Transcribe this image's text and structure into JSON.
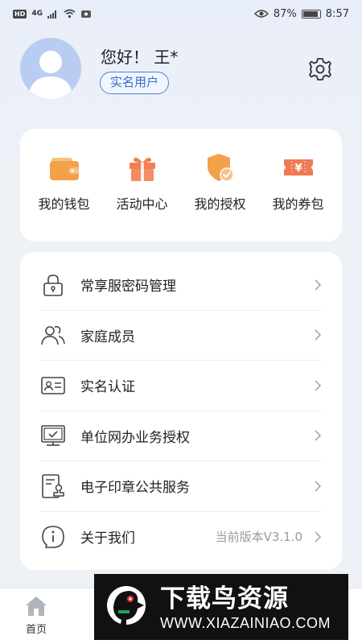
{
  "status_bar": {
    "hd": "HD",
    "network": "4G",
    "battery": "87%",
    "time": "8:57"
  },
  "profile": {
    "greeting": "您好！ 王*",
    "badge": "实名用户"
  },
  "quick_actions": [
    {
      "label": "我的钱包",
      "icon": "wallet-icon",
      "color": "#f4a14c"
    },
    {
      "label": "活动中心",
      "icon": "gift-icon",
      "color": "#f07f57"
    },
    {
      "label": "我的授权",
      "icon": "shield-check-icon",
      "color": "#f4a14c"
    },
    {
      "label": "我的券包",
      "icon": "coupon-icon",
      "color": "#f07a55"
    }
  ],
  "menu": [
    {
      "label": "常享服密码管理",
      "icon": "lock-icon",
      "extra": ""
    },
    {
      "label": "家庭成员",
      "icon": "family-icon",
      "extra": ""
    },
    {
      "label": "实名认证",
      "icon": "id-card-icon",
      "extra": ""
    },
    {
      "label": "单位网办业务授权",
      "icon": "monitor-check-icon",
      "extra": ""
    },
    {
      "label": "电子印章公共服务",
      "icon": "seal-document-icon",
      "extra": ""
    },
    {
      "label": "关于我们",
      "icon": "info-icon",
      "extra": "当前版本V3.1.0"
    }
  ],
  "bottom_nav": {
    "home_label": "首页"
  },
  "watermark": {
    "title": "下载鸟资源",
    "url": "WWW.XIAZAINIAO.COM"
  }
}
